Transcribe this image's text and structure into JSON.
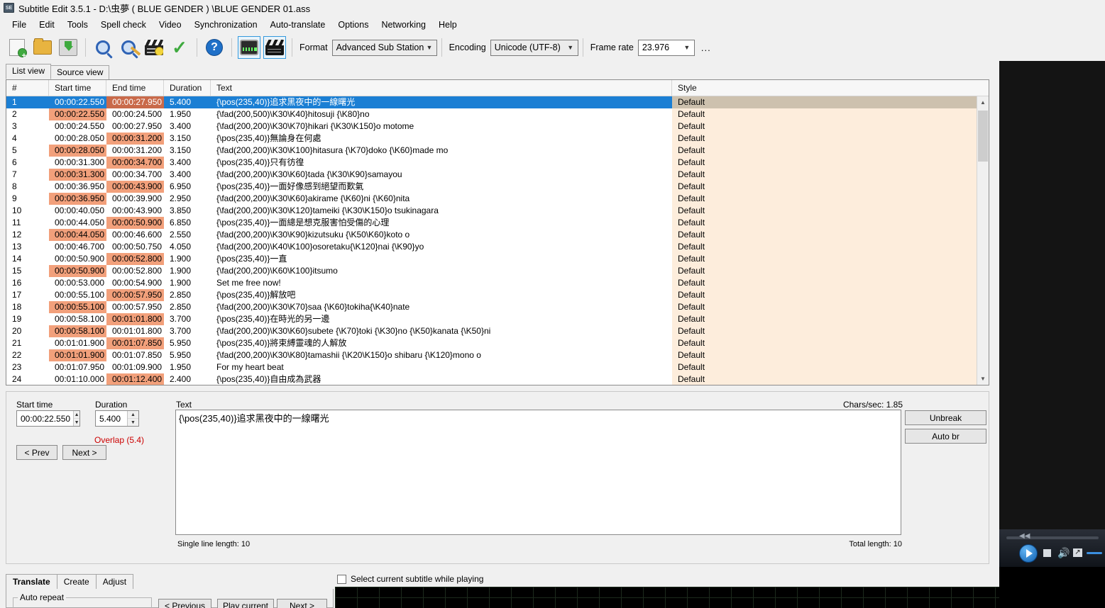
{
  "window": {
    "title": "Subtitle Edit 3.5.1 - D:\\虫夢 ( BLUE GENDER ) \\BLUE GENDER 01.ass",
    "icon": "SE"
  },
  "menu": {
    "items": [
      {
        "label": "File"
      },
      {
        "label": "Edit"
      },
      {
        "label": "Tools"
      },
      {
        "label": "Spell check"
      },
      {
        "label": "Video"
      },
      {
        "label": "Synchronization"
      },
      {
        "label": "Auto-translate"
      },
      {
        "label": "Options"
      },
      {
        "label": "Networking"
      },
      {
        "label": "Help"
      }
    ]
  },
  "toolbar": {
    "icons": [
      {
        "name": "new-file-icon"
      },
      {
        "name": "open-folder-icon"
      },
      {
        "name": "save-icon"
      },
      {
        "name": "find-icon"
      },
      {
        "name": "replace-icon"
      },
      {
        "name": "sync-timing-icon"
      },
      {
        "name": "spell-check-icon"
      },
      {
        "name": "help-icon"
      },
      {
        "name": "waveform-toggle-icon"
      },
      {
        "name": "video-toggle-icon"
      }
    ],
    "format_label": "Format",
    "format_value": "Advanced Sub Station",
    "encoding_label": "Encoding",
    "encoding_value": "Unicode (UTF-8)",
    "framerate_label": "Frame rate",
    "framerate_value": "23.976",
    "more_button": "..."
  },
  "view_tabs": [
    {
      "label": "List view",
      "active": true
    },
    {
      "label": "Source view",
      "active": false
    }
  ],
  "list": {
    "columns": [
      "#",
      "Start time",
      "End time",
      "Duration",
      "Text",
      "Style"
    ],
    "rows": [
      {
        "num": "1",
        "start": "00:00:22.550",
        "end": "00:00:27.950",
        "dur": "5.400",
        "text": "{\\pos(235,40)}追求黑夜中的一線曙光",
        "style": "Default",
        "selected": true,
        "start_hl": false,
        "end_hl": true
      },
      {
        "num": "2",
        "start": "00:00:22.550",
        "end": "00:00:24.500",
        "dur": "1.950",
        "text": "{\\fad(200,500)\\K30\\K40}hitosuji {\\K80}no",
        "style": "Default",
        "selected": false,
        "start_hl": true,
        "end_hl": false
      },
      {
        "num": "3",
        "start": "00:00:24.550",
        "end": "00:00:27.950",
        "dur": "3.400",
        "text": "{\\fad(200,200)\\K30\\K70}hikari  {\\K30\\K150}o motome",
        "style": "Default",
        "selected": false,
        "start_hl": false,
        "end_hl": false
      },
      {
        "num": "4",
        "start": "00:00:28.050",
        "end": "00:00:31.200",
        "dur": "3.150",
        "text": "{\\pos(235,40)}無論身在何處",
        "style": "Default",
        "selected": false,
        "start_hl": false,
        "end_hl": true
      },
      {
        "num": "5",
        "start": "00:00:28.050",
        "end": "00:00:31.200",
        "dur": "3.150",
        "text": "{\\fad(200,200)\\K30\\K100}hitasura {\\K70}doko {\\K60}made mo",
        "style": "Default",
        "selected": false,
        "start_hl": true,
        "end_hl": false
      },
      {
        "num": "6",
        "start": "00:00:31.300",
        "end": "00:00:34.700",
        "dur": "3.400",
        "text": "{\\pos(235,40)}只有彷徨",
        "style": "Default",
        "selected": false,
        "start_hl": false,
        "end_hl": true
      },
      {
        "num": "7",
        "start": "00:00:31.300",
        "end": "00:00:34.700",
        "dur": "3.400",
        "text": "{\\fad(200,200)\\K30\\K60}tada {\\K30\\K90}samayou",
        "style": "Default",
        "selected": false,
        "start_hl": true,
        "end_hl": false
      },
      {
        "num": "8",
        "start": "00:00:36.950",
        "end": "00:00:43.900",
        "dur": "6.950",
        "text": "{\\pos(235,40)}一面好像感到絕望而歎氣",
        "style": "Default",
        "selected": false,
        "start_hl": false,
        "end_hl": true
      },
      {
        "num": "9",
        "start": "00:00:36.950",
        "end": "00:00:39.900",
        "dur": "2.950",
        "text": "{\\fad(200,200)\\K30\\K60}akirame {\\K60}ni {\\K60}nita",
        "style": "Default",
        "selected": false,
        "start_hl": true,
        "end_hl": false
      },
      {
        "num": "10",
        "start": "00:00:40.050",
        "end": "00:00:43.900",
        "dur": "3.850",
        "text": "{\\fad(200,200)\\K30\\K120}tameiki {\\K30\\K150}o tsukinagara",
        "style": "Default",
        "selected": false,
        "start_hl": false,
        "end_hl": false
      },
      {
        "num": "11",
        "start": "00:00:44.050",
        "end": "00:00:50.900",
        "dur": "6.850",
        "text": "{\\pos(235,40)}一面總是想克服害怕受傷的心理",
        "style": "Default",
        "selected": false,
        "start_hl": false,
        "end_hl": true
      },
      {
        "num": "12",
        "start": "00:00:44.050",
        "end": "00:00:46.600",
        "dur": "2.550",
        "text": "{\\fad(200,200)\\K30\\K90}kizutsuku {\\K50\\K60}koto o",
        "style": "Default",
        "selected": false,
        "start_hl": true,
        "end_hl": false
      },
      {
        "num": "13",
        "start": "00:00:46.700",
        "end": "00:00:50.750",
        "dur": "4.050",
        "text": "{\\fad(200,200)\\K40\\K100}osoretaku{\\K120}nai  {\\K90}yo",
        "style": "Default",
        "selected": false,
        "start_hl": false,
        "end_hl": false
      },
      {
        "num": "14",
        "start": "00:00:50.900",
        "end": "00:00:52.800",
        "dur": "1.900",
        "text": "{\\pos(235,40)}一直",
        "style": "Default",
        "selected": false,
        "start_hl": false,
        "end_hl": true
      },
      {
        "num": "15",
        "start": "00:00:50.900",
        "end": "00:00:52.800",
        "dur": "1.900",
        "text": "{\\fad(200,200)\\K60\\K100}itsumo",
        "style": "Default",
        "selected": false,
        "start_hl": true,
        "end_hl": false
      },
      {
        "num": "16",
        "start": "00:00:53.000",
        "end": "00:00:54.900",
        "dur": "1.900",
        "text": "Set me free now!",
        "style": "Default",
        "selected": false,
        "start_hl": false,
        "end_hl": false
      },
      {
        "num": "17",
        "start": "00:00:55.100",
        "end": "00:00:57.950",
        "dur": "2.850",
        "text": "{\\pos(235,40)}解放吧",
        "style": "Default",
        "selected": false,
        "start_hl": false,
        "end_hl": true
      },
      {
        "num": "18",
        "start": "00:00:55.100",
        "end": "00:00:57.950",
        "dur": "2.850",
        "text": "{\\fad(200,200)\\K30\\K70}saa  {\\K60}tokiha{\\K40}nate",
        "style": "Default",
        "selected": false,
        "start_hl": true,
        "end_hl": false
      },
      {
        "num": "19",
        "start": "00:00:58.100",
        "end": "00:01:01.800",
        "dur": "3.700",
        "text": "{\\pos(235,40)}在時光的另一邊",
        "style": "Default",
        "selected": false,
        "start_hl": false,
        "end_hl": true
      },
      {
        "num": "20",
        "start": "00:00:58.100",
        "end": "00:01:01.800",
        "dur": "3.700",
        "text": "{\\fad(200,200)\\K30\\K60}subete {\\K70}toki {\\K30}no {\\K50}kanata {\\K50}ni",
        "style": "Default",
        "selected": false,
        "start_hl": true,
        "end_hl": false
      },
      {
        "num": "21",
        "start": "00:01:01.900",
        "end": "00:01:07.850",
        "dur": "5.950",
        "text": "{\\pos(235,40)}將束縛靈魂的人解放",
        "style": "Default",
        "selected": false,
        "start_hl": false,
        "end_hl": true
      },
      {
        "num": "22",
        "start": "00:01:01.900",
        "end": "00:01:07.850",
        "dur": "5.950",
        "text": "{\\fad(200,200)\\K30\\K80}tamashii {\\K20\\K150}o shibaru {\\K120}mono o",
        "style": "Default",
        "selected": false,
        "start_hl": true,
        "end_hl": false
      },
      {
        "num": "23",
        "start": "00:01:07.950",
        "end": "00:01:09.900",
        "dur": "1.950",
        "text": "For my heart beat",
        "style": "Default",
        "selected": false,
        "start_hl": false,
        "end_hl": false
      },
      {
        "num": "24",
        "start": "00:01:10.000",
        "end": "00:01:12.400",
        "dur": "2.400",
        "text": "{\\pos(235,40)}自由成為武器",
        "style": "Default",
        "selected": false,
        "start_hl": false,
        "end_hl": true
      }
    ]
  },
  "editor": {
    "start_time_label": "Start time",
    "start_time_value": "00:00:22.550",
    "duration_label": "Duration",
    "duration_value": "5.400",
    "overlap_warning": "Overlap (5.4)",
    "prev_button": "< Prev",
    "next_button": "Next >",
    "text_label": "Text",
    "text_value": "{\\pos(235,40)}追求黑夜中的一線曙光",
    "chars_per_sec": "Chars/sec: 1.85",
    "unbreak_button": "Unbreak",
    "autobr_button": "Auto br",
    "single_line_length": "Single line length: 10",
    "total_length": "Total length: 10"
  },
  "bottom": {
    "tabs": [
      {
        "label": "Translate",
        "active": true
      },
      {
        "label": "Create",
        "active": false
      },
      {
        "label": "Adjust",
        "active": false
      }
    ],
    "auto_repeat_group": "Auto repeat",
    "previous_button": "< Previous",
    "play_current_button": "Play current",
    "next_button": "Next >",
    "select_while_playing": "Select current subtitle while playing"
  },
  "colors": {
    "selection": "#1b7fd4",
    "overlap_highlight": "#f2a07b",
    "style_cell": "#fdeddc",
    "warning_text": "#cc0000",
    "toggle_border": "#3399dd"
  }
}
